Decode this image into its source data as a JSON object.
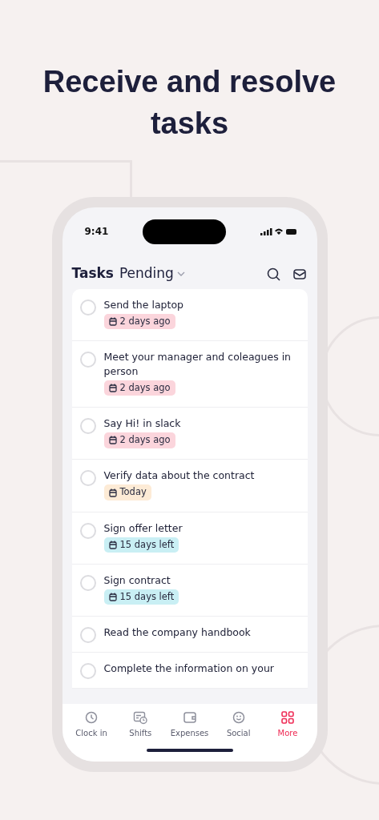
{
  "headline": "Receive and resolve tasks",
  "status_bar": {
    "time": "9:41"
  },
  "header": {
    "title": "Tasks",
    "filter": "Pending"
  },
  "tasks": [
    {
      "title": "Send the laptop",
      "checked": false,
      "due": "2 days ago",
      "color": "#fbd5dc"
    },
    {
      "title": "Meet your manager and coleagues in person",
      "checked": false,
      "due": "2 days ago",
      "color": "#fbd5dc"
    },
    {
      "title": "Say Hi! in slack",
      "checked": false,
      "due": "2 days ago",
      "color": "#fbd5dc"
    },
    {
      "title": "Verify data about the contract",
      "checked": false,
      "due": "Today",
      "color": "#fdebd6"
    },
    {
      "title": "Sign offer letter",
      "checked": false,
      "due": "15 days left",
      "color": "#c9eff4"
    },
    {
      "title": "Sign contract",
      "checked": false,
      "due": "15 days left",
      "color": "#c9eff4"
    },
    {
      "title": "Read the company handbook",
      "checked": false
    },
    {
      "title": "Complete the information on your",
      "checked": false
    }
  ],
  "tab_bar": [
    {
      "label": "Clock in",
      "selected": false
    },
    {
      "label": "Shifts",
      "selected": false
    },
    {
      "label": "Expenses",
      "selected": false
    },
    {
      "label": "Social",
      "selected": false
    },
    {
      "label": "More",
      "selected": true
    }
  ]
}
